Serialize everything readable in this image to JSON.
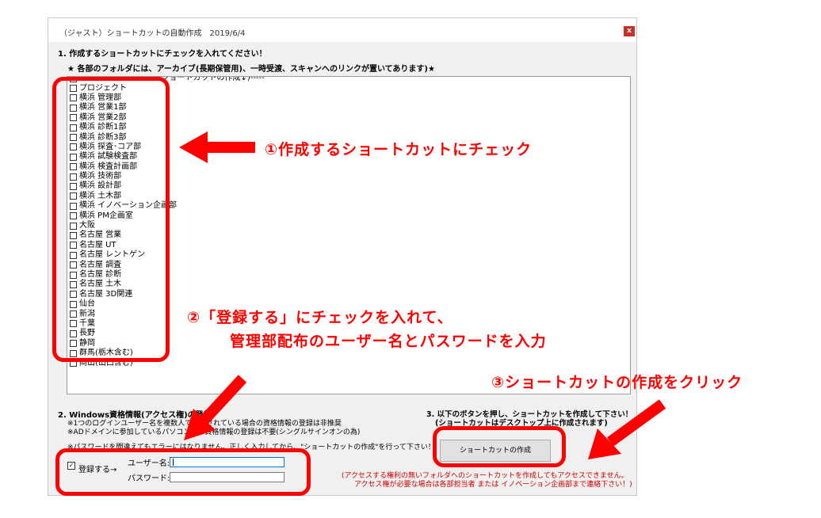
{
  "window": {
    "title": "（ジャスト）ショートカットの自動作成　2019/6/4",
    "close_label": "x"
  },
  "section1": {
    "heading": "1. 作成するショートカットにチェックを入れてください！",
    "note": "★ 各部のフォルダには、アーカイブ(長期保管用)、一時受渡、スキャンへのリンクが置いてあります)★"
  },
  "folders": [
    "-----(↓ 各部フォルダのショートカットの作成↓)-----",
    "プロジェクト",
    "横浜 管理部",
    "横浜 営業1部",
    "横浜 営業2部",
    "横浜 診断1部",
    "横浜 診断3部",
    "横浜 探査･コア部",
    "横浜 試験検査部",
    "横浜 検査計画部",
    "横浜 技術部",
    "横浜 設計部",
    "横浜 土木部",
    "横浜 イノベーション企画部",
    "横浜 PM企画室",
    "大阪",
    "名古屋 営業",
    "名古屋 UT",
    "名古屋 レントゲン",
    "名古屋 調査",
    "名古屋 診断",
    "名古屋 土木",
    "名古屋 3D関連",
    "仙台",
    "新潟",
    "千葉",
    "長野",
    "静岡",
    "群馬(栃木含む)",
    "岡山(山口含む)"
  ],
  "section2": {
    "heading": "2. Windows資格情報(アクセス権)の登録",
    "note1": "※1つのログインユーザー名を複数人で共有されている場合の資格情報の登録は非推奨",
    "note2": "※ADドメインに参加しているパソコンでは資格情報の登録は不要(シングルサインオンの為)",
    "note3": "※パスワードを間違えてもエラーにはなりません。正しく入力してから、\"ショートカットの作成\"を行って下さい！",
    "register_label": "登録する→",
    "register_checked": true,
    "username_label": "ユーザー名:",
    "username_value": "",
    "password_label": "パスワード:",
    "password_value": ""
  },
  "section3": {
    "heading1": "3. 以下のボタンを押し、ショートカットを作成して下さい！",
    "heading2": "(ショートカットはデスクトップ上に作成されます)",
    "create_button": "ショートカットの作成",
    "warning1": "(アクセスする権利の無いフォルダへのショートカットを作成してもアクセスできません。",
    "warning2": "アクセス権が必要な場合は各部担当者 または イノベーション企画部まで連絡下さい！)"
  },
  "annotations": {
    "step1": "①作成するショートカットにチェック",
    "step2_line1": "②「登録する」にチェックを入れて、",
    "step2_line2": "管理部配布のユーザー名とパスワードを入力",
    "step3": "③ショートカットの作成をクリック",
    "color": "#ff0000"
  }
}
